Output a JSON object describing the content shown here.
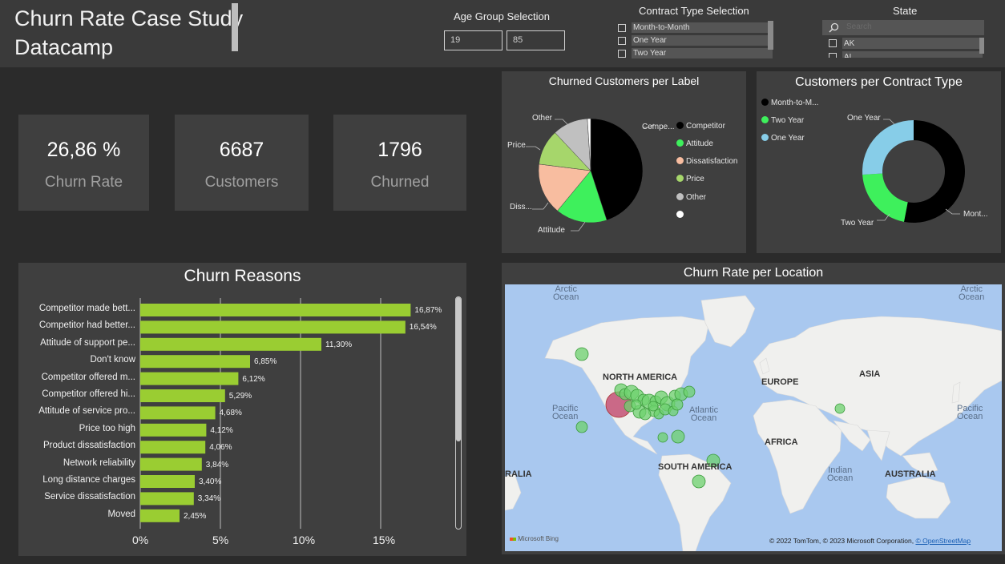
{
  "header": {
    "title_line1": "Churn Rate Case Study",
    "title_line2": "Datacamp",
    "age_slicer": {
      "label": "Age Group Selection",
      "min": "19",
      "max": "85"
    },
    "contract_slicer": {
      "label": "Contract Type Selection",
      "options": [
        "Month-to-Month",
        "One Year",
        "Two Year"
      ]
    },
    "state_slicer": {
      "label": "State",
      "search_placeholder": "Search",
      "options": [
        "AK",
        "AL"
      ]
    }
  },
  "kpis": [
    {
      "value": "26,86 %",
      "label": "Churn Rate"
    },
    {
      "value": "6687",
      "label": "Customers"
    },
    {
      "value": "1796",
      "label": "Churned"
    }
  ],
  "pie_panel": {
    "title": "Churned Customers per Label",
    "callouts": [
      "Compe...",
      "Attitude",
      "Diss...",
      "Price",
      "Other"
    ],
    "legend": [
      "Competitor",
      "Attitude",
      "Dissatisfaction",
      "Price",
      "Other",
      ""
    ]
  },
  "donut_panel": {
    "title": "Customers per Contract Type",
    "legend": [
      "Month-to-M...",
      "Two Year",
      "One Year"
    ],
    "callouts": [
      "One Year",
      "Two Year",
      "Mont..."
    ]
  },
  "bar_panel": {
    "title": "Churn Reasons",
    "axis_ticks": [
      "0%",
      "5%",
      "10%",
      "15%"
    ]
  },
  "map_panel": {
    "title": "Churn Rate per Location",
    "oceans": [
      "Arctic\nOcean",
      "Arctic\nOcean",
      "Pacific\nOcean",
      "Atlantic\nOcean",
      "Pacific\nOcean",
      "Indian\nOcean"
    ],
    "continents": [
      "NORTH AMERICA",
      "EUROPE",
      "ASIA",
      "AFRICA",
      "SOUTH AMERICA",
      "AUSTRALIA",
      "RALIA"
    ],
    "bing_logo": "Microsoft Bing",
    "attribution": "© 2022 TomTom, © 2023 Microsoft Corporation, ",
    "attribution_link": "© OpenStreetMap"
  },
  "colors": {
    "competitor": "#000000",
    "attitude": "#3ef05c",
    "dissatisfaction": "#f8bda0",
    "price": "#a6d66b",
    "other": "#c0c0c0",
    "blank": "#ffffff",
    "month_to_month": "#000000",
    "two_year": "#3ef05c",
    "one_year": "#87cde8",
    "bar": "#9acd32",
    "map_water": "#a9c8ef",
    "map_land": "#f0f0ee"
  },
  "chart_data": [
    {
      "type": "pie",
      "title": "Churned Customers per Label",
      "categories": [
        "Competitor",
        "Attitude",
        "Dissatisfaction",
        "Price",
        "Other",
        ""
      ],
      "values": [
        45,
        16,
        16,
        11,
        11,
        1
      ]
    },
    {
      "type": "pie",
      "title": "Customers per Contract Type",
      "categories": [
        "Month-to-Month",
        "Two Year",
        "One Year"
      ],
      "values": [
        53,
        21,
        26
      ]
    },
    {
      "type": "bar",
      "title": "Churn Reasons",
      "categories": [
        "Competitor made bett...",
        "Competitor had better...",
        "Attitude of support pe...",
        "Don't know",
        "Competitor offered m...",
        "Competitor offered hi...",
        "Attitude of service pro...",
        "Price too high",
        "Product dissatisfaction",
        "Network reliability",
        "Long distance charges",
        "Service dissatisfaction",
        "Moved"
      ],
      "values": [
        16.87,
        16.54,
        11.3,
        6.85,
        6.12,
        5.29,
        4.68,
        4.12,
        4.06,
        3.84,
        3.4,
        3.34,
        2.45
      ],
      "value_labels": [
        "16,87%",
        "16,54%",
        "11,30%",
        "6,85%",
        "6,12%",
        "5,29%",
        "4,68%",
        "4,12%",
        "4,06%",
        "3,84%",
        "3,40%",
        "3,34%",
        "2,45%"
      ],
      "xlim": [
        0,
        20
      ]
    }
  ]
}
